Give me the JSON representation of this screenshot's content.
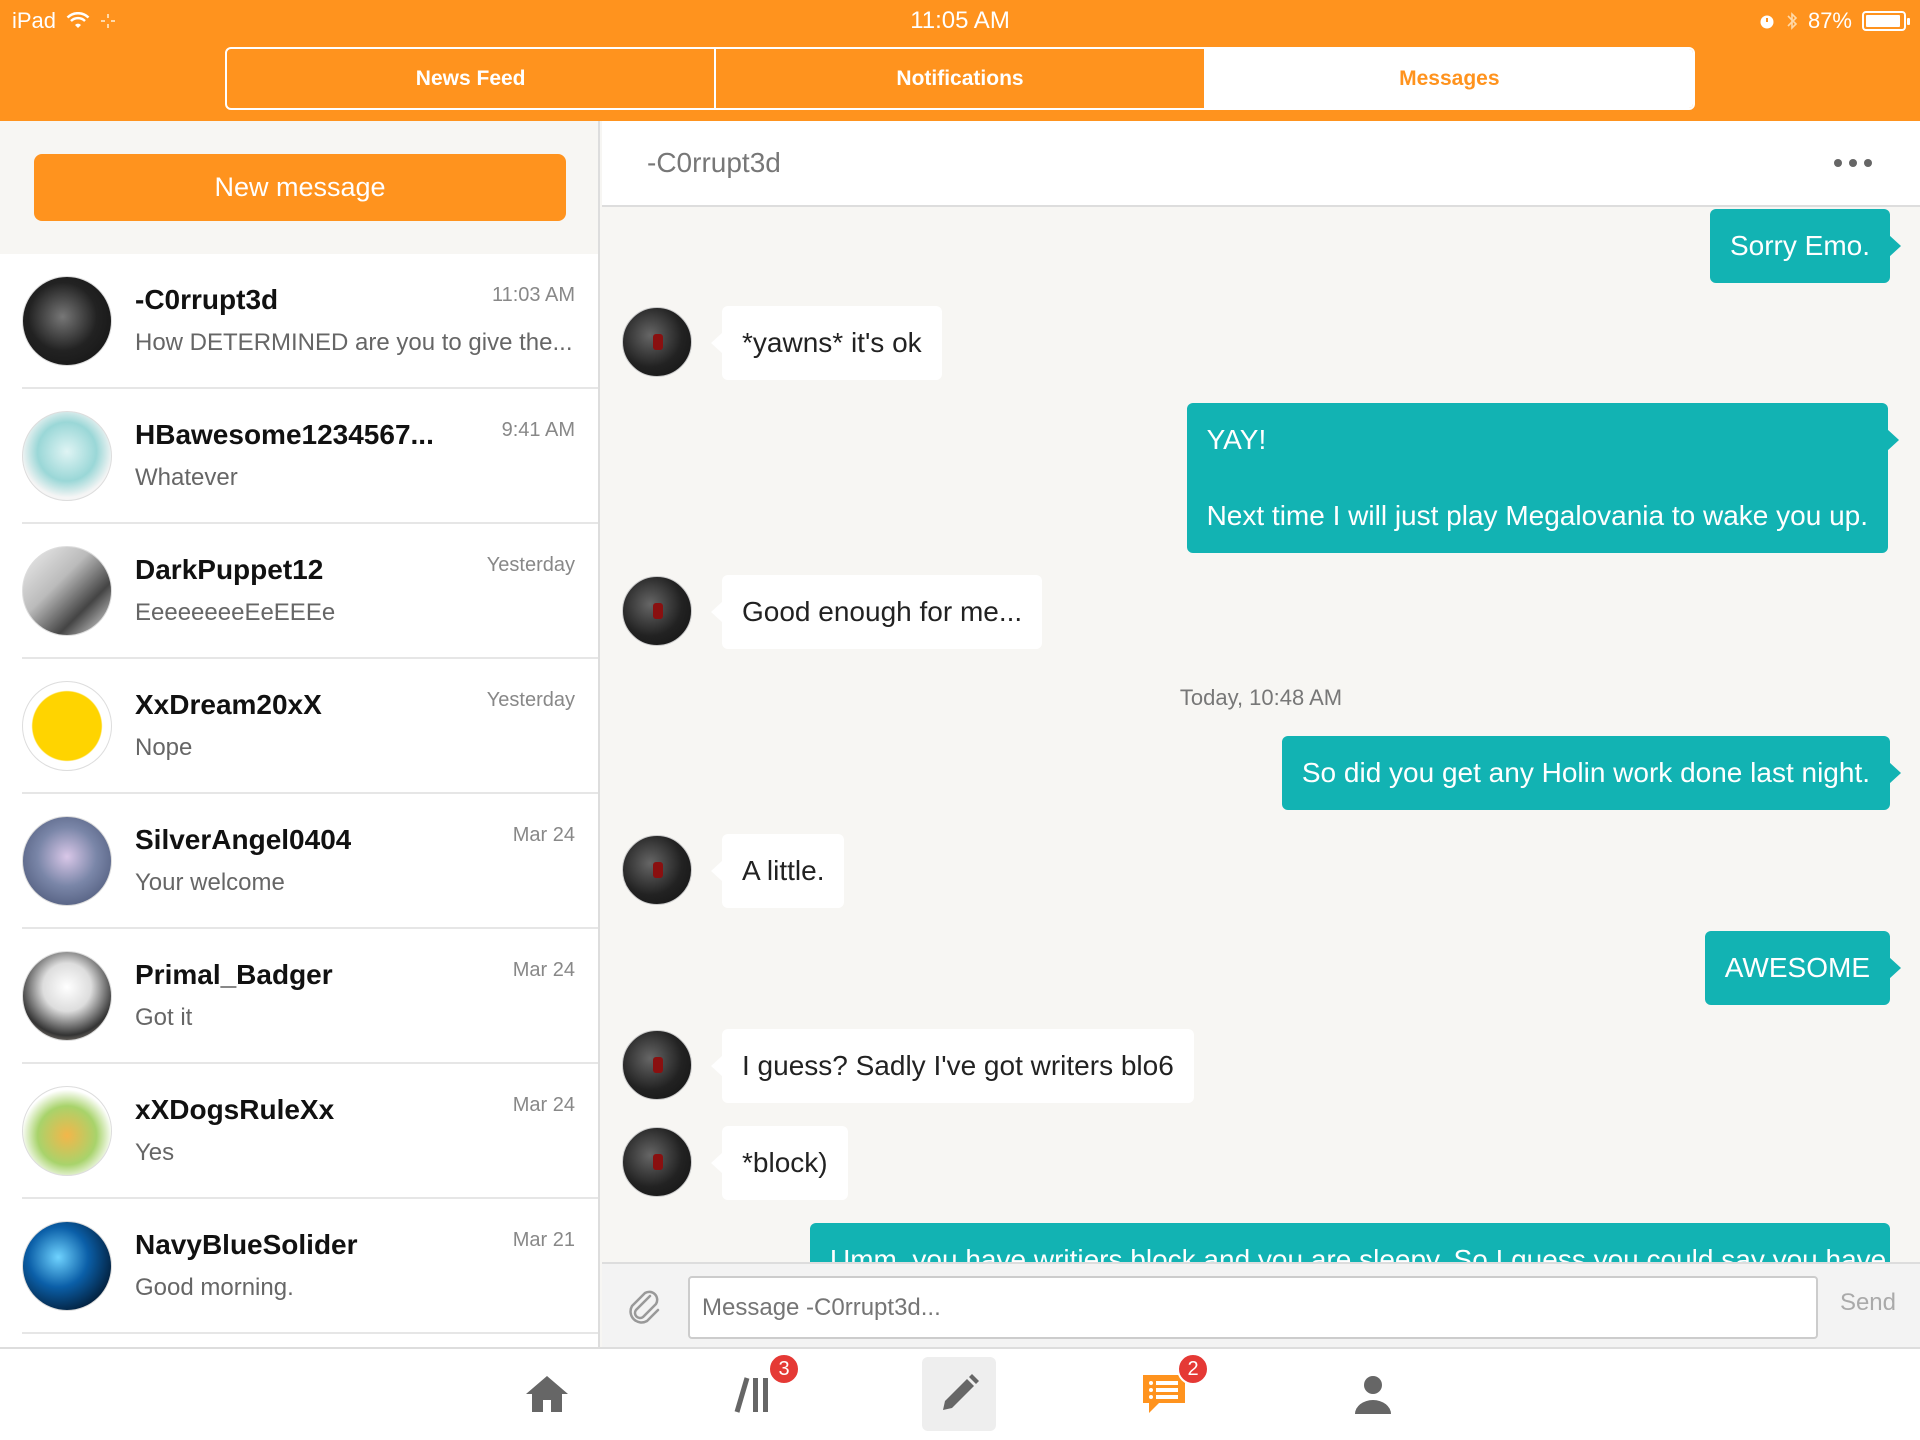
{
  "status_bar": {
    "device": "iPad",
    "time": "11:05 AM",
    "battery": "87%"
  },
  "header_tabs": [
    {
      "label": "News Feed"
    },
    {
      "label": "Notifications"
    },
    {
      "label": "Messages"
    }
  ],
  "sidebar": {
    "new_message_label": "New message",
    "conversations": [
      {
        "name": "-C0rrupt3d",
        "preview": "How DETERMINED are you to give the...",
        "time": "11:03 AM"
      },
      {
        "name": "HBawesome1234567...",
        "preview": "Whatever",
        "time": "9:41 AM"
      },
      {
        "name": "DarkPuppet12",
        "preview": "EeeeeeeeEeEEEe",
        "time": "Yesterday"
      },
      {
        "name": "XxDream20xX",
        "preview": "Nope",
        "time": "Yesterday"
      },
      {
        "name": "SilverAngel0404",
        "preview": "Your welcome",
        "time": "Mar 24"
      },
      {
        "name": "Primal_Badger",
        "preview": "Got it",
        "time": "Mar 24"
      },
      {
        "name": "xXDogsRuleXx",
        "preview": "Yes",
        "time": "Mar 24"
      },
      {
        "name": "NavyBlueSolider",
        "preview": "Good morning.",
        "time": "Mar 21"
      }
    ]
  },
  "chat": {
    "title": "-C0rrupt3d",
    "messages": [
      {
        "direction": "out",
        "text": "Sorry Emo."
      },
      {
        "direction": "in",
        "text": "*yawns* it's ok"
      },
      {
        "direction": "out",
        "line1": "YAY!",
        "line2": "Next time I will just play Megalovania to wake you up."
      },
      {
        "direction": "in",
        "text": "Good enough for me..."
      },
      {
        "day_label": "Today, 10:48 AM"
      },
      {
        "direction": "out",
        "text": "So did you get any Holin work done last night."
      },
      {
        "direction": "in",
        "text": "A little."
      },
      {
        "direction": "out",
        "text": "AWESOME"
      },
      {
        "direction": "in",
        "text": "I guess? Sadly I've got writers blo6"
      },
      {
        "direction": "in",
        "text": "*block)"
      },
      {
        "direction": "out",
        "text": "Umm, you have writiers block and you are sleepy. So I guess you could say you have"
      }
    ],
    "composer": {
      "placeholder": "Message -C0rrupt3d...",
      "send_label": "Send"
    }
  },
  "tabbar": {
    "library_badge": "3",
    "messages_badge": "2"
  },
  "colors": {
    "accent": "#ff931e",
    "bubble_out": "#12b3b3"
  }
}
